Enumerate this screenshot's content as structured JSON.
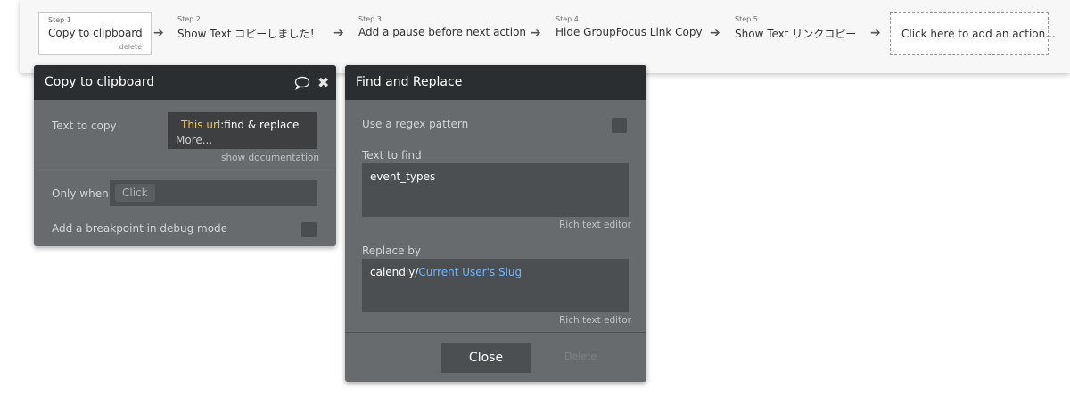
{
  "workflow": {
    "steps": [
      {
        "number": "Step 1",
        "title": "Copy to clipboard",
        "delete_label": "delete"
      },
      {
        "number": "Step 2",
        "title": "Show Text コピーしました！"
      },
      {
        "number": "Step 3",
        "title": "Add a pause before next action"
      },
      {
        "number": "Step 4",
        "title": "Hide GroupFocus Link Copy"
      },
      {
        "number": "Step 5",
        "title": "Show Text リンクコピー"
      }
    ],
    "add_action_label": "Click here to add an action..."
  },
  "copy_panel": {
    "title": "Copy to clipboard",
    "text_to_copy_label": "Text to copy",
    "text_value_keyword": "This url",
    "text_value_op": ":find & replace",
    "more_label": "More...",
    "show_documentation": "show documentation",
    "only_when_label": "Only when",
    "only_when_placeholder": "Click",
    "breakpoint_label": "Add a breakpoint in debug mode"
  },
  "find_panel": {
    "title": "Find and Replace",
    "regex_label": "Use a regex pattern",
    "text_to_find_label": "Text to find",
    "text_to_find_value": "event_types",
    "rich_text_editor": "Rich text editor",
    "replace_by_label": "Replace by",
    "replace_static": "calendly/",
    "replace_dynamic": "Current User's Slug",
    "close_label": "Close",
    "delete_label": "Delete"
  },
  "colors": {
    "panel_bg": "#676b6e",
    "panel_header": "#2b2e30",
    "dynamic_expression": "#6eb6ff",
    "keyword": "#f5c542"
  }
}
